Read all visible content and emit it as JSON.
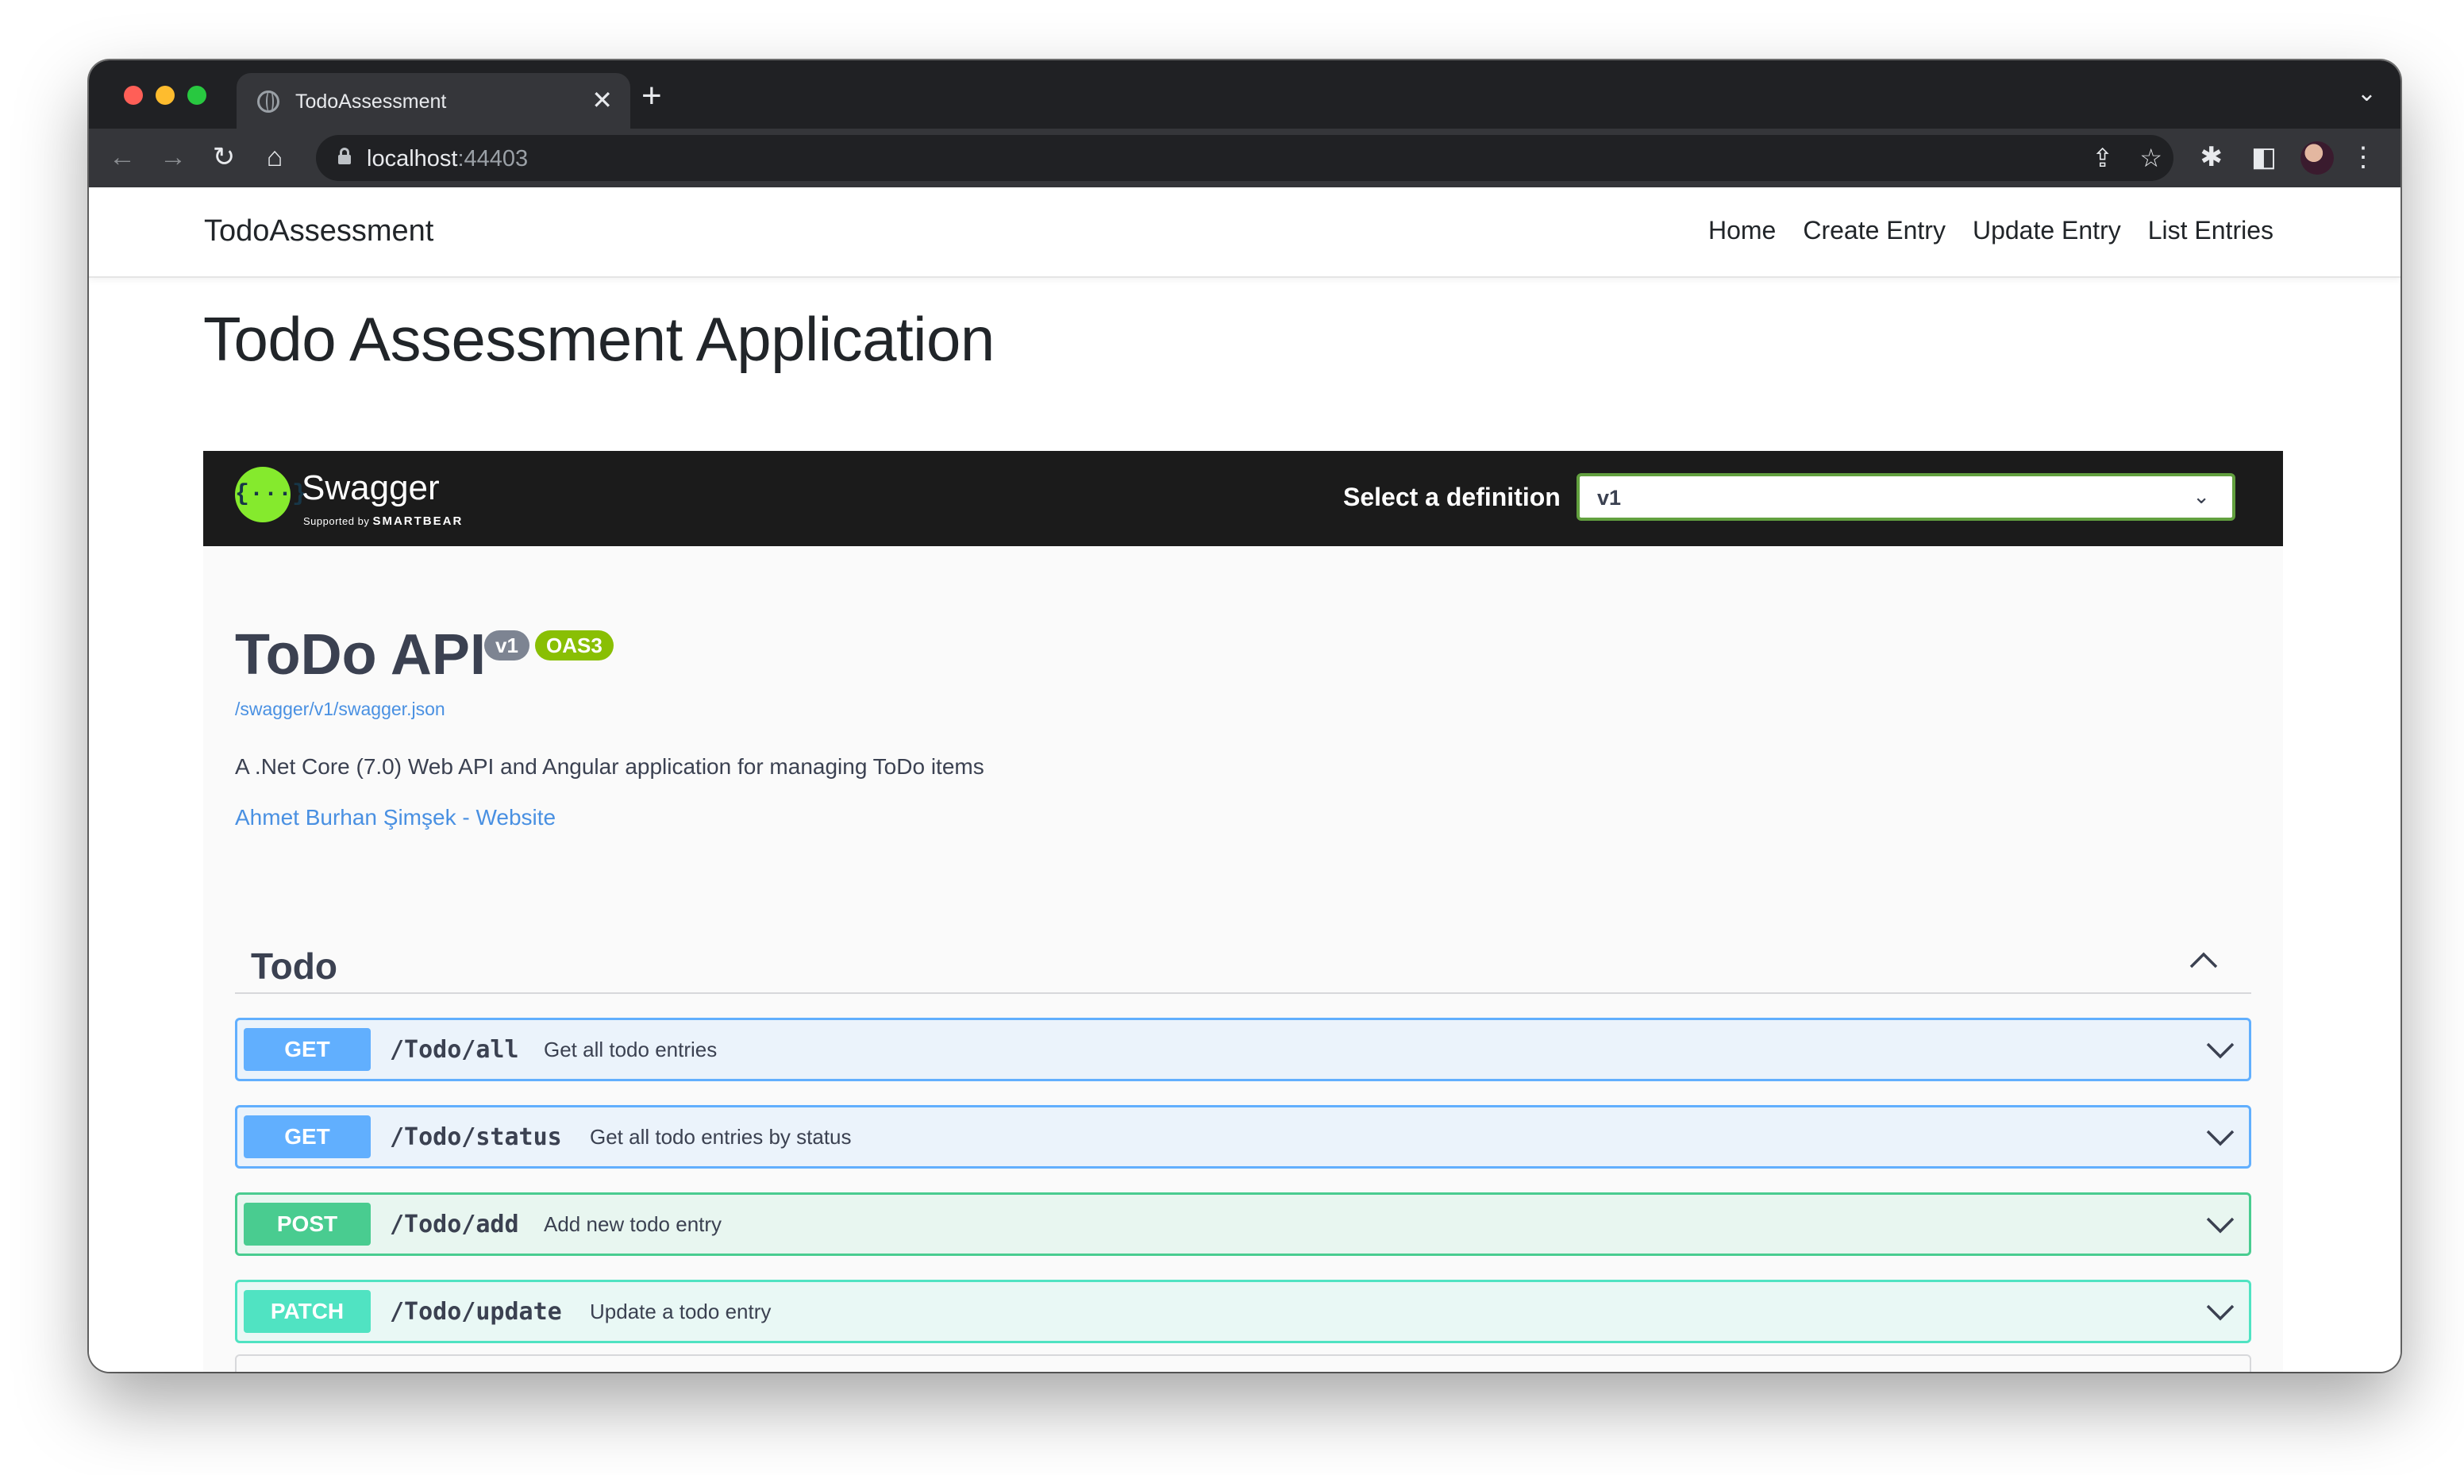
{
  "browser": {
    "tab_title": "TodoAssessment",
    "tab_close": "✕",
    "new_tab": "+",
    "url_host": "localhost",
    "url_port": ":44403"
  },
  "app": {
    "brand": "TodoAssessment",
    "nav": [
      "Home",
      "Create Entry",
      "Update Entry",
      "List Entries"
    ],
    "page_title": "Todo Assessment Application"
  },
  "swagger": {
    "logo_text": "Swagger",
    "logo_sub_prefix": "Supported by",
    "logo_sub_brand": "SMARTBEAR",
    "select_label": "Select a definition",
    "select_value": "v1",
    "info": {
      "title": "ToDo API",
      "version_badge": "v1",
      "oas_badge": "OAS3",
      "spec_url": "/swagger/v1/swagger.json",
      "description": "A .Net Core (7.0) Web API and Angular application for managing ToDo items",
      "contact": "Ahmet Burhan Şimşek - Website"
    },
    "tag": "Todo",
    "operations": [
      {
        "method": "GET",
        "path": "/Todo/all",
        "summary": "Get all todo entries"
      },
      {
        "method": "GET",
        "path": "/Todo/status",
        "summary": "Get all todo entries by status"
      },
      {
        "method": "POST",
        "path": "/Todo/add",
        "summary": "Add new todo entry"
      },
      {
        "method": "PATCH",
        "path": "/Todo/update",
        "summary": "Update a todo entry"
      }
    ]
  },
  "colors": {
    "get": "#61affe",
    "post": "#49cc90",
    "patch": "#50e3c2",
    "swagger_green": "#85ea2d"
  }
}
